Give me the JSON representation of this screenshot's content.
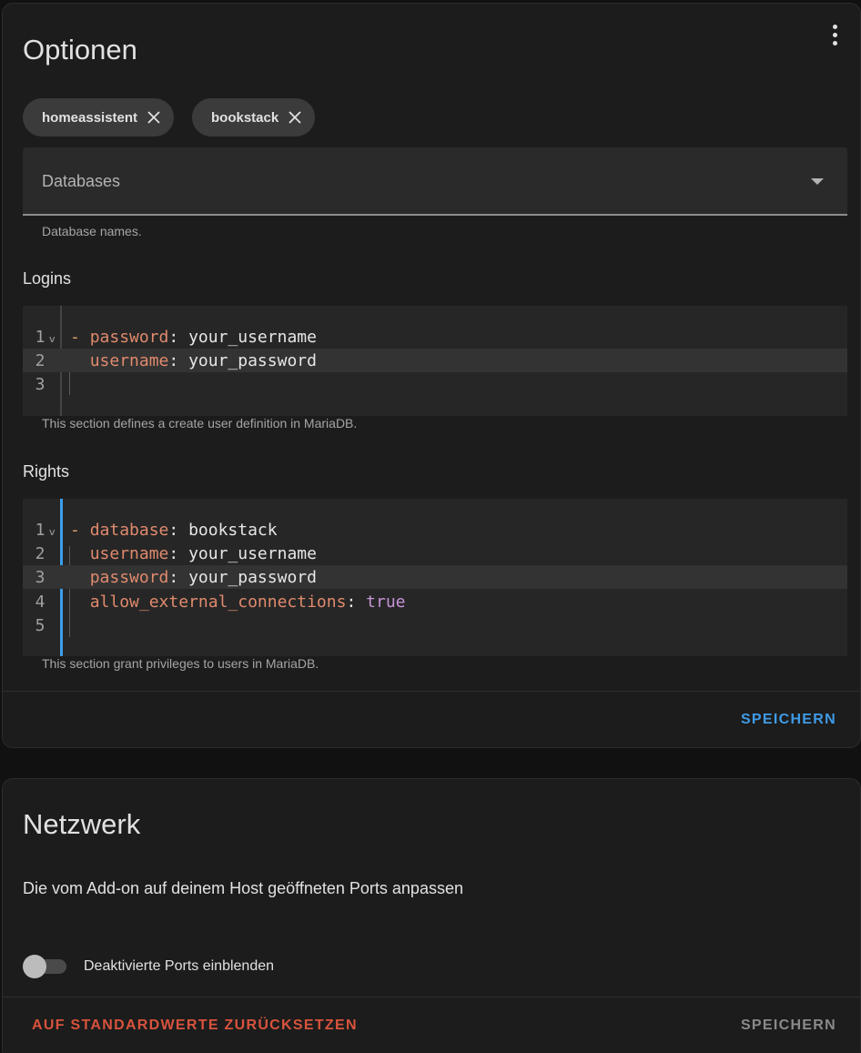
{
  "options": {
    "title": "Optionen",
    "menu_icon": "more-vertical-icon",
    "chips": [
      {
        "label": "homeassistent",
        "icon": "close-icon"
      },
      {
        "label": "bookstack",
        "icon": "close-icon"
      }
    ],
    "databases": {
      "label": "Databases",
      "icon": "dropdown-arrow-icon",
      "helper": "Database names."
    },
    "logins": {
      "label": "Logins",
      "lines": [
        {
          "num": "1",
          "fold": "v",
          "dash": "- ",
          "key": "password",
          "sep": ": ",
          "value": "your_username"
        },
        {
          "num": "2",
          "fold": "",
          "dash": "  ",
          "key": "username",
          "sep": ": ",
          "value": "your_password"
        },
        {
          "num": "3",
          "fold": "",
          "dash": "",
          "key": "",
          "sep": "",
          "value": ""
        }
      ],
      "helper": "This section defines a create user definition in MariaDB."
    },
    "rights": {
      "label": "Rights",
      "lines": [
        {
          "num": "1",
          "fold": "v",
          "dash": "- ",
          "key": "database",
          "sep": ": ",
          "value": "bookstack"
        },
        {
          "num": "2",
          "fold": "",
          "dash": "  ",
          "key": "username",
          "sep": ": ",
          "value": "your_username"
        },
        {
          "num": "3",
          "fold": "",
          "dash": "  ",
          "key": "password",
          "sep": ": ",
          "value": "your_password"
        },
        {
          "num": "4",
          "fold": "",
          "dash": "  ",
          "key": "allow_external_connections",
          "sep": ": ",
          "value": "true"
        },
        {
          "num": "5",
          "fold": "",
          "dash": "",
          "key": "",
          "sep": "",
          "value": ""
        }
      ],
      "helper": "This section grant privileges to users in MariaDB."
    },
    "save_label": "SPEICHERN"
  },
  "network": {
    "title": "Netzwerk",
    "description": "Die vom Add-on auf deinem Host geöffneten Ports anpassen",
    "toggle_label": "Deaktivierte Ports einblenden",
    "toggle_on": false,
    "reset_label": "AUF STANDARDWERTE ZURÜCKSETZEN",
    "save_label": "SPEICHERN"
  },
  "colors": {
    "accent": "#3f9be6",
    "danger": "#d8533d",
    "yaml_key": "#e08a6d",
    "yaml_bool": "#c595d6"
  }
}
